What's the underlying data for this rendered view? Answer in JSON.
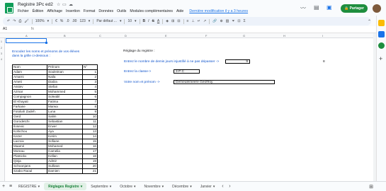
{
  "app": {
    "title": "Registre 3Pc ed2",
    "last_edit": "Dernière modification il y a 3 heures",
    "share_label": "Partager"
  },
  "menu": [
    "Fichier",
    "Édition",
    "Affichage",
    "Insertion",
    "Format",
    "Données",
    "Outils",
    "Modules complémentaires",
    "Aide"
  ],
  "toolbar": {
    "zoom": "100%",
    "currency": "€",
    "percent": "%",
    "decimals_dec": ".0",
    "decimals_inc": ".00",
    "number_format": "123",
    "font": "Par défaut ...",
    "font_size": "10",
    "bold": "B",
    "italic": "I",
    "strike": "S",
    "text_color": "A"
  },
  "formula": {
    "cell_ref": "A1",
    "fx": "fx"
  },
  "columns": [
    "A",
    "B",
    "C",
    "D",
    "E",
    "F",
    "G",
    "H",
    "I"
  ],
  "sheet": {
    "instructions_line1": "Encodez les noms et prénoms de vos élèves",
    "instructions_line2": "dans la grille ci-dessous :",
    "settings_title": "Réglage du registre :",
    "max_absences_label": "Entrez le nombre de demis jours injustifié à ne pas dépasser ->",
    "max_absences_value": "9",
    "max_absences_side": "8",
    "class_label": "Entrez la classe->",
    "class_value": "3 P C",
    "teacher_label": "Votre nom et prénom ->",
    "teacher_value": "Demeulemeere Geoffroy"
  },
  "students": {
    "headers": [
      "Nom",
      "Prénom",
      "N°"
    ],
    "rows": [
      [
        "Adam",
        "Souleiman",
        "1"
      ],
      [
        "Amarni",
        "Naila",
        "2"
      ],
      [
        "Ameti",
        "Dialza",
        "3"
      ],
      [
        "Assiev",
        "Stefan",
        "4"
      ],
      [
        "Azmar",
        "Mohammed",
        "5"
      ],
      [
        "Compagnon",
        "Soleabil",
        "6"
      ],
      [
        "El Khayati",
        "Fatima",
        "7"
      ],
      [
        "Farkane",
        "Marwa",
        "8"
      ],
      [
        "Fotoliah Zadeh",
        "Luna",
        "9"
      ],
      [
        "Gerd",
        "Salim",
        "10"
      ],
      [
        "Gorodetchi",
        "Sebastian",
        "11"
      ],
      [
        "Ilosevic",
        "Enver",
        "12"
      ],
      [
        "Kohichou",
        "Aya",
        "13"
      ],
      [
        "Kezer",
        "Kerim",
        "14"
      ],
      [
        "Lacroix",
        "Sofiane",
        "15"
      ],
      [
        "Maamri",
        "Mohamed",
        "16"
      ],
      [
        "Moreau",
        "Camelia",
        "17"
      ],
      [
        "Platnickx",
        "Kellan",
        "18"
      ],
      [
        "Qinja",
        "Admir",
        "19"
      ],
      [
        "Schoonjans",
        "Sullivan",
        "20"
      ],
      [
        "Szabo Raoul",
        "Damien",
        "21"
      ]
    ]
  },
  "tabs": [
    {
      "label": "REGISTRE",
      "active": false
    },
    {
      "label": "Réglages Registre",
      "active": true
    },
    {
      "label": "Septembre",
      "active": false
    },
    {
      "label": "Octobre",
      "active": false
    },
    {
      "label": "Novembre",
      "active": false
    },
    {
      "label": "Décembre",
      "active": false
    },
    {
      "label": "Janvier",
      "active": false
    }
  ],
  "colors": {
    "accent_green": "#1e8e3e",
    "link_blue": "#1155cc",
    "active_tab_bg": "#e1f0e6"
  }
}
